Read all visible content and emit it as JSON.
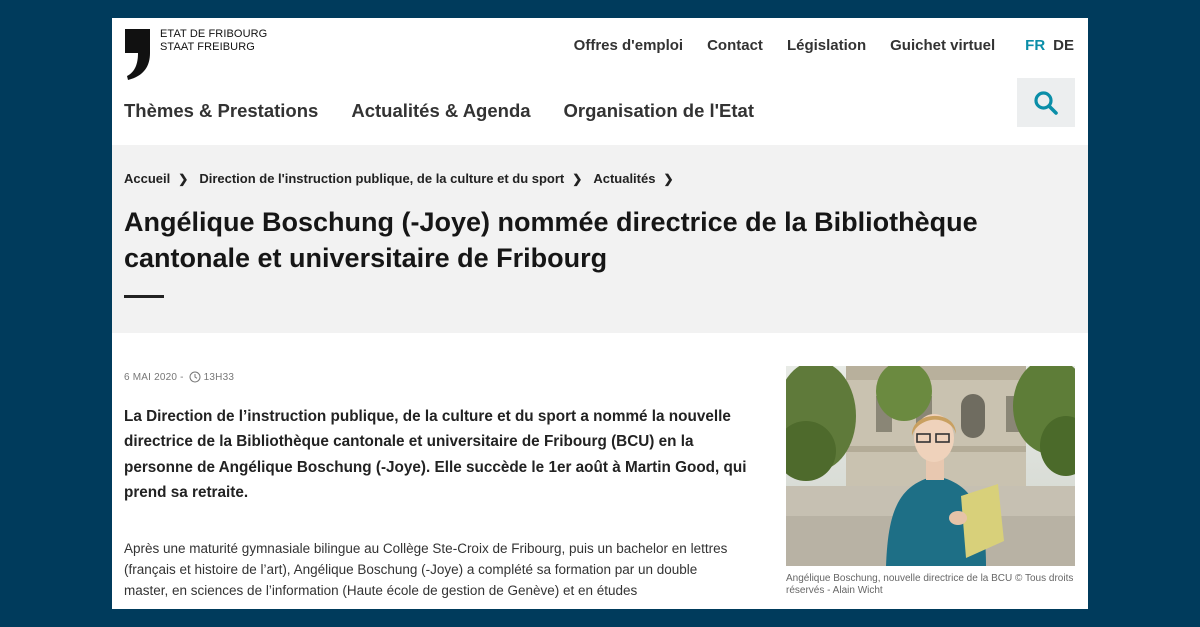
{
  "header": {
    "logo_line1": "ETAT DE FRIBOURG",
    "logo_line2": "STAAT FREIBURG",
    "top_links": [
      "Offres d'emploi",
      "Contact",
      "Législation",
      "Guichet virtuel"
    ],
    "lang_active": "FR",
    "lang_other": "DE",
    "main_nav": [
      "Thèmes & Prestations",
      "Actualités & Agenda",
      "Organisation de l'Etat"
    ]
  },
  "breadcrumb": [
    "Accueil",
    "Direction de l'instruction publique, de la culture et du sport",
    "Actualités"
  ],
  "article": {
    "title": "Angélique Boschung (-Joye) nommée directrice de la Bibliothèque cantonale et universitaire de Fribourg",
    "date": "6 MAI 2020 -",
    "time": "13H33",
    "lead": "La Direction de l’instruction publique, de la culture et du sport a nommé la nouvelle directrice de la Bibliothèque cantonale et universitaire de Fribourg (BCU) en la personne de Angélique Boschung (-Joye). Elle succède le 1er août à Martin Good, qui prend sa retraite.",
    "body": "Après une maturité gymnasiale bilingue au Collège Ste-Croix de Fribourg, puis un bachelor en lettres (français et histoire de l’art), Angélique Boschung (-Joye) a complété sa formation par un double master, en sciences de l’information (Haute école de gestion de Genève) et en études",
    "image_caption": "Angélique Boschung, nouvelle directrice de la BCU © Tous droits réservés - Alain Wicht"
  },
  "colors": {
    "background": "#003b5c",
    "accent": "#0a8ea8",
    "band": "#f2f2f2"
  }
}
